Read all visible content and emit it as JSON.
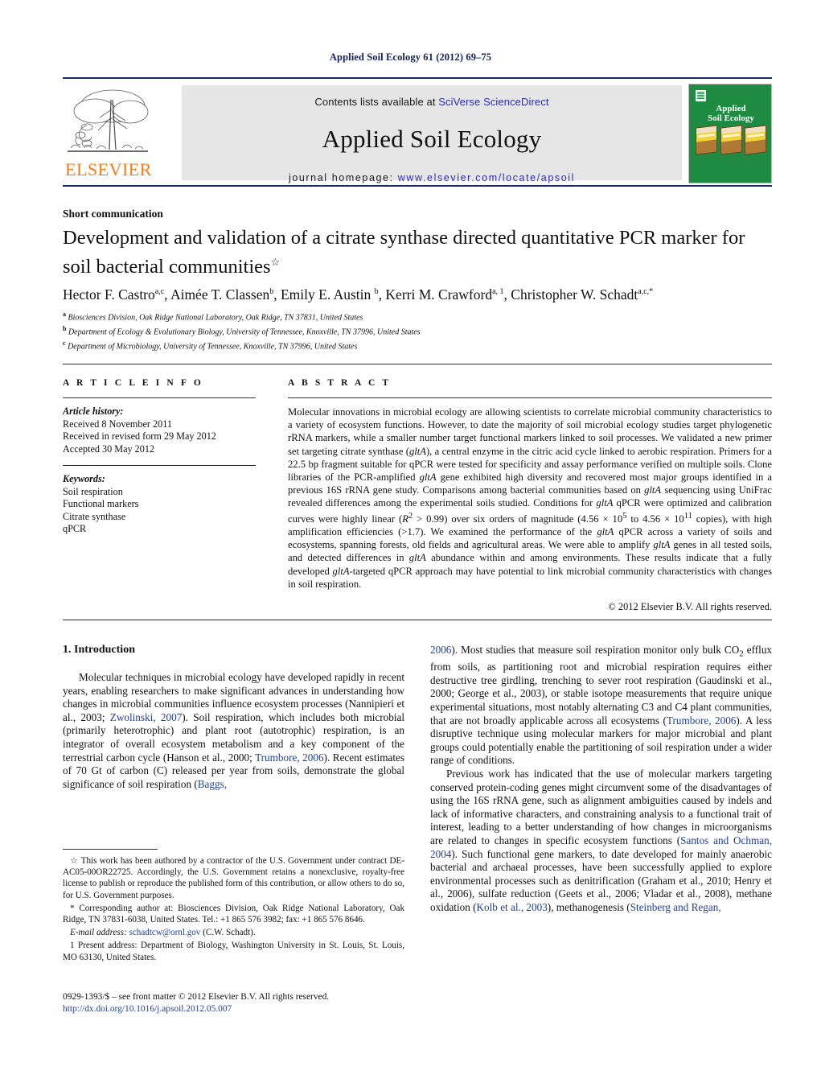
{
  "running_head": "Applied Soil Ecology 61 (2012) 69–75",
  "masthead": {
    "contents_prefix": "Contents lists available at ",
    "contents_link": "SciVerse ScienceDirect",
    "journal_title": "Applied Soil Ecology",
    "homepage_prefix": "journal homepage: ",
    "homepage_link": "www.elsevier.com/locate/apsoil",
    "publisher_wordmark": "ELSEVIER",
    "cover_title": "Applied\nSoil Ecology",
    "accent_orange": "#ef7d1a",
    "accent_blue": "#2b2bbb",
    "cover_green": "#1e8a42",
    "rule_navy": "#1a2a66"
  },
  "article": {
    "type": "Short communication",
    "title": "Development and validation of a citrate synthase directed quantitative PCR marker for soil bacterial communities",
    "title_marker": "☆",
    "authors_html": "Hector F. Castro<sup>a,c</sup>, Aimée T. Classen<sup>b</sup>, Emily E. Austin <sup>b</sup>, Kerri M. Crawford<sup>a, 1</sup>, Christopher W. Schadt<sup>a,c,</sup><sup>*</sup>",
    "affiliations": [
      "a Biosciences Division, Oak Ridge National Laboratory, Oak Ridge, TN 37831, United States",
      "b Department of Ecology & Evolutionary Biology, University of Tennessee, Knoxville, TN 37996, United States",
      "c Department of Microbiology, University of Tennessee, Knoxville, TN 37996, United States"
    ]
  },
  "article_info": {
    "label": "A R T I C L E    I N F O",
    "history_label": "Article history:",
    "history": [
      "Received 8 November 2011",
      "Received in revised form 29 May 2012",
      "Accepted 30 May 2012"
    ],
    "keywords_label": "Keywords:",
    "keywords": [
      "Soil respiration",
      "Functional markers",
      "Citrate synthase",
      "qPCR"
    ]
  },
  "abstract": {
    "label": "A B S T R A C T",
    "text": "Molecular innovations in microbial ecology are allowing scientists to correlate microbial community characteristics to a variety of ecosystem functions. However, to date the majority of soil microbial ecology studies target phylogenetic rRNA markers, while a smaller number target functional markers linked to soil processes. We validated a new primer set targeting citrate synthase (gltA), a central enzyme in the citric acid cycle linked to aerobic respiration. Primers for a 22.5 bp fragment suitable for qPCR were tested for specificity and assay performance verified on multiple soils. Clone libraries of the PCR-amplified gltA gene exhibited high diversity and recovered most major groups identified in a previous 16S rRNA gene study. Comparisons among bacterial communities based on gltA sequencing using UniFrac revealed differences among the experimental soils studied. Conditions for gltA qPCR were optimized and calibration curves were highly linear (R2 > 0.99) over six orders of magnitude (4.56 × 10^5 to 4.56 × 10^11 copies), with high amplification efficiencies (>1.7). We examined the performance of the gltA qPCR across a variety of soils and ecosystems, spanning forests, old fields and agricultural areas. We were able to amplify gltA genes in all tested soils, and detected differences in gltA abundance within and among environments. These results indicate that a fully developed gltA-targeted qPCR approach may have potential to link microbial community characteristics with changes in soil respiration.",
    "copyright": "© 2012 Elsevier B.V. All rights reserved."
  },
  "introduction": {
    "heading": "1.  Introduction",
    "paragraph_1": "Molecular techniques in microbial ecology have developed rapidly in recent years, enabling researchers to make significant advances in understanding how changes in microbial communities influence ecosystem processes (Nannipieri et al., 2003; Zwolinski, 2007). Soil respiration, which includes both microbial (primarily heterotrophic) and plant root (autotrophic) respiration, is an integrator of overall ecosystem metabolism and a key component of the terrestrial carbon cycle (Hanson et al., 2000; Trumbore, 2006). Recent estimates of 70 Gt of carbon (C) released per year from soils, demonstrate the global significance of soil respiration (Baggs,",
    "paragraph_1_cont": "2006). Most studies that measure soil respiration monitor only bulk CO2 efflux from soils, as partitioning root and microbial respiration requires either destructive tree girdling, trenching to sever root respiration (Gaudinski et al., 2000; George et al., 2003), or stable isotope measurements that require unique experimental situations, most notably alternating C3 and C4 plant communities, that are not broadly applicable across all ecosystems (Trumbore, 2006). A less disruptive technique using molecular markers for major microbial and plant groups could potentially enable the partitioning of soil respiration under a wider range of conditions.",
    "paragraph_2": "Previous work has indicated that the use of molecular markers targeting conserved protein-coding genes might circumvent some of the disadvantages of using the 16S rRNA gene, such as alignment ambiguities caused by indels and lack of informative characters, and constraining analysis to a functional trait of interest, leading to a better understanding of how changes in microorganisms are related to changes in specific ecosystem functions (Santos and Ochman, 2004). Such functional gene markers, to date developed for mainly anaerobic bacterial and archaeal processes, have been successfully applied to explore environmental processes such as denitrification (Graham et al., 2010; Henry et al., 2006), sulfate reduction (Geets et al., 2006; Vladar et al., 2008), methane oxidation (Kolb et al., 2003), methanogenesis (Steinberg and Regan,"
  },
  "footnotes": {
    "star_note": "☆ This work has been authored by a contractor of the U.S. Government under contract DE-AC05-00OR22725. Accordingly, the U.S. Government retains a nonexclusive, royalty-free license to publish or reproduce the published form of this contribution, or allow others to do so, for U.S. Government purposes.",
    "corresponding": "* Corresponding author at: Biosciences Division, Oak Ridge National Laboratory, Oak Ridge, TN 37831-6038, United States. Tel.: +1 865 576 3982; fax: +1 865 576 8646.",
    "email_label": "E-mail address:",
    "email": "schadtcw@ornl.gov",
    "email_suffix": "(C.W. Schadt).",
    "present_address": "1 Present address: Department of Biology, Washington University in St. Louis, St. Louis, MO 63130, United States."
  },
  "imprint": {
    "issn_line": "0929-1393/$ – see front matter © 2012 Elsevier B.V. All rights reserved.",
    "doi": "http://dx.doi.org/10.1016/j.apsoil.2012.05.007"
  }
}
